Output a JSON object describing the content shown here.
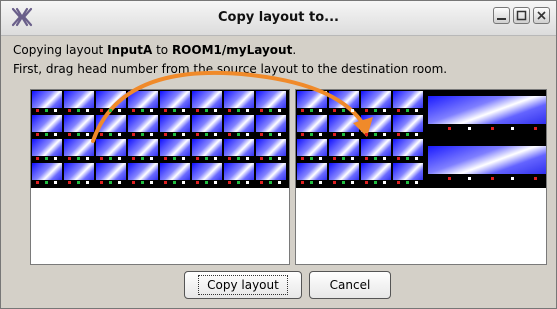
{
  "window": {
    "title": "Copy layout to...",
    "controls": [
      "minimize",
      "maximize",
      "close"
    ]
  },
  "info": {
    "line1_prefix": "Copying layout ",
    "source_layout": "InputA",
    "line1_middle": " to ",
    "destination": "ROOM1/myLayout",
    "line1_suffix": ".",
    "line2": "First, drag head number from the source layout to the destination room."
  },
  "source_panel": {
    "rows": 4,
    "cols": 8
  },
  "destination_panel": {
    "rows": 4,
    "cols": 4,
    "large_tiles": 2
  },
  "buttons": {
    "copy": "Copy layout",
    "cancel": "Cancel"
  },
  "colors": {
    "accent_arrow": "#f08a2a",
    "tile_blue": "#1818ff",
    "background": "#d4d0c8"
  }
}
